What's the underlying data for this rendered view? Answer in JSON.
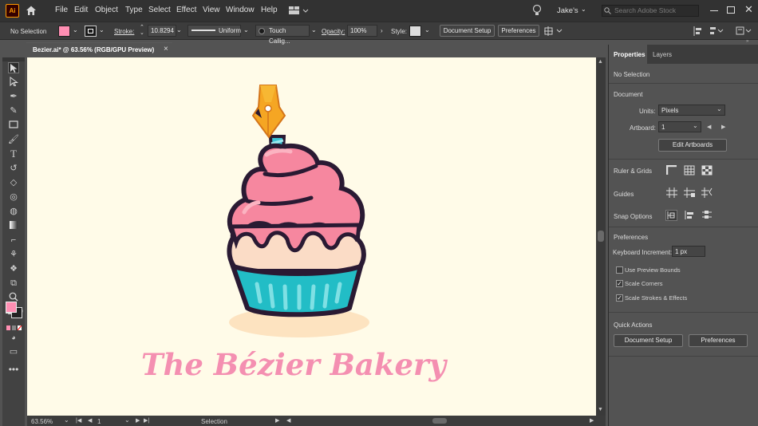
{
  "app": {
    "logo": "Ai",
    "menu": [
      "File",
      "Edit",
      "Object",
      "Type",
      "Select",
      "Effect",
      "View",
      "Window",
      "Help"
    ],
    "user": "Jake's",
    "search_placeholder": "Search Adobe Stock"
  },
  "control": {
    "selection_label": "No Selection",
    "stroke_label": "Stroke:",
    "stroke_value": "10.8294",
    "stroke_profile": "Uniform",
    "brush": "Touch Callig...",
    "opacity_label": "Opacity:",
    "opacity_value": "100%",
    "style_label": "Style:",
    "document_setup": "Document Setup",
    "preferences": "Preferences",
    "fill_color": "#ff8fb3"
  },
  "document": {
    "tab_title": "Bezier.ai* @ 63.56% (RGB/GPU Preview)",
    "close": "×",
    "artwork_text": "The Bézier Bakery",
    "colors": {
      "frosting": "#f6879f",
      "frosting_light": "#fbb3c1",
      "cake": "#fbdcc6",
      "cup": "#22bdc6",
      "outline": "#2a1a33",
      "candle": "#3cc4d4",
      "nib": "#f5a623",
      "shadow": "#fde3c0",
      "text": "#f48fb1"
    }
  },
  "status": {
    "zoom": "63.56%",
    "artboard": "1",
    "tool": "Selection"
  },
  "panel": {
    "tabs": [
      "Properties",
      "Layers"
    ],
    "selection": "No Selection",
    "document_heading": "Document",
    "units_label": "Units:",
    "units_value": "Pixels",
    "artboard_label": "Artboard:",
    "artboard_value": "1",
    "edit_artboards": "Edit Artboards",
    "ruler_grids": "Ruler & Grids",
    "guides": "Guides",
    "snap_options": "Snap Options",
    "preferences_heading": "Preferences",
    "keyboard_increment_label": "Keyboard Increment:",
    "keyboard_increment_value": "1 px",
    "checkboxes": [
      {
        "label": "Use Preview Bounds",
        "checked": false
      },
      {
        "label": "Scale Corners",
        "checked": true
      },
      {
        "label": "Scale Strokes & Effects",
        "checked": true
      }
    ],
    "quick_actions": "Quick Actions",
    "document_setup": "Document Setup",
    "preferences_button": "Preferences"
  }
}
